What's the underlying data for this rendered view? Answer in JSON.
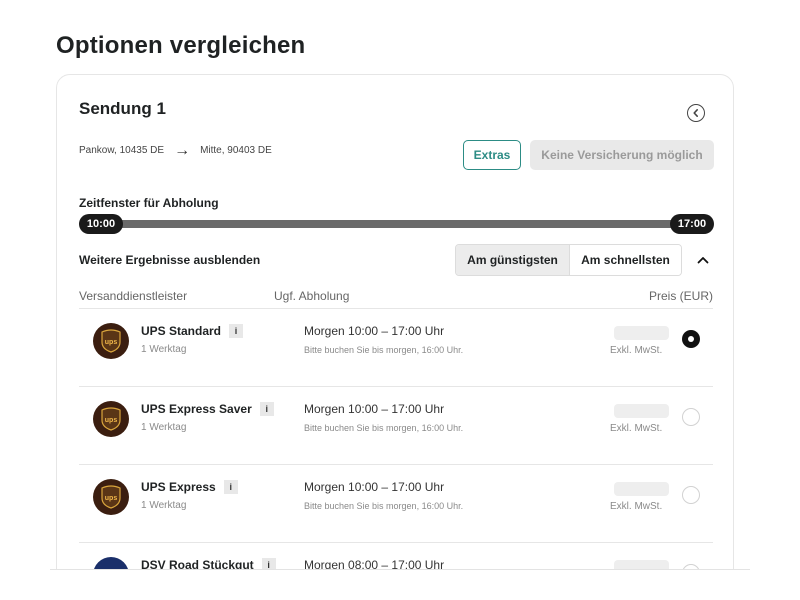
{
  "page": {
    "title": "Optionen vergleichen"
  },
  "shipment": {
    "title": "Sendung 1",
    "origin": "Pankow, 10435 DE",
    "destination": "Mitte, 90403 DE",
    "extras_label": "Extras",
    "insurance_label": "Keine Versicherung möglich",
    "pickup_window_label": "Zeitfenster für Abholung",
    "pickup_window_start": "10:00",
    "pickup_window_end": "17:00"
  },
  "results": {
    "hide_label": "Weitere Ergebnisse ausblenden",
    "sort_cheapest": "Am günstigsten",
    "sort_fastest": "Am schnellsten",
    "active_sort": "Am günstigsten"
  },
  "table": {
    "col_carrier": "Versanddienstleister",
    "col_pickup": "Ugf. Abholung",
    "col_price": "Preis (EUR)"
  },
  "offers": [
    {
      "name": "UPS Standard",
      "info": "i",
      "transit": "1 Werktag",
      "logo": "ups",
      "pickup": "Morgen 10:00 – 17:00 Uhr",
      "note": "Bitte buchen Sie bis morgen, 16:00 Uhr.",
      "vat": "Exkl. MwSt.",
      "selected": true
    },
    {
      "name": "UPS Express Saver",
      "info": "i",
      "transit": "1 Werktag",
      "logo": "ups",
      "pickup": "Morgen 10:00 – 17:00 Uhr",
      "note": "Bitte buchen Sie bis morgen, 16:00 Uhr.",
      "vat": "Exkl. MwSt.",
      "selected": false
    },
    {
      "name": "UPS Express",
      "info": "i",
      "transit": "1 Werktag",
      "logo": "ups",
      "pickup": "Morgen 10:00 – 17:00 Uhr",
      "note": "Bitte buchen Sie bis morgen, 16:00 Uhr.",
      "vat": "Exkl. MwSt.",
      "selected": false
    },
    {
      "name": "DSV Road Stückgut",
      "info": "i",
      "transit": "",
      "logo": "dsv",
      "pickup": "Morgen 08:00 – 17:00 Uhr",
      "note": "",
      "vat": "",
      "selected": false
    }
  ],
  "colors": {
    "accent": "#2c8c85",
    "ups_brown": "#3b1e10",
    "dsv_blue": "#1a2f6a",
    "slider": "#6a6a6a"
  }
}
